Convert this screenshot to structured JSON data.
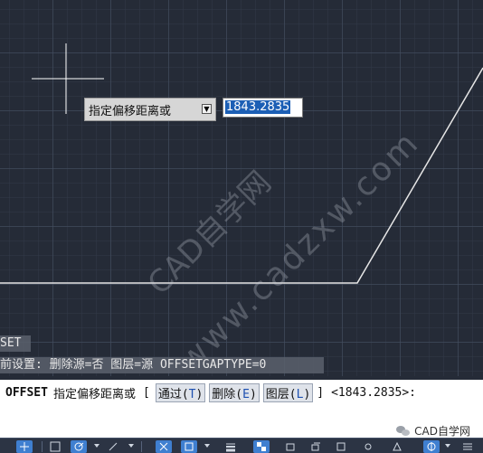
{
  "viewport": {
    "tooltip_prompt": "指定偏移距离或",
    "input_value": "1843.2835",
    "watermark_primary": "CAD自学网",
    "watermark_secondary": "www.cadzxw.com"
  },
  "command_history": {
    "line1": "SET",
    "line2": "前设置: 删除源=否  图层=源  OFFSETGAPTYPE=0"
  },
  "command_line": {
    "command": "OFFSET",
    "prompt": "指定偏移距离或",
    "open_bracket": "[",
    "options": [
      {
        "label": "通过(",
        "key": "T",
        "close": ")"
      },
      {
        "label": "删除(",
        "key": "E",
        "close": ")"
      },
      {
        "label": "图层(",
        "key": "L",
        "close": ")"
      }
    ],
    "close_bracket": "]",
    "default": "<1843.2835>:"
  },
  "footer": {
    "brand": "CAD自学网"
  },
  "status_bar": {
    "buttons": [
      "model-space-icon",
      "grid-icon",
      "snap-icon",
      "ortho-icon",
      "polar-icon",
      "isodraft-icon",
      "object-snap-tracking-icon",
      "object-snap-icon",
      "lineweight-icon",
      "transparency-icon",
      "selection-cycling-icon",
      "3d-osnap-icon",
      "dynamic-ucs-icon",
      "selection-filter-icon",
      "gizmo-icon",
      "annotation-visibility-icon",
      "autoscale-icon",
      "annotation-scale-icon",
      "workspace-icon",
      "customize-icon"
    ]
  },
  "colors": {
    "canvas_bg": "#252b37",
    "accent_blue": "#1c5fb5",
    "status_active": "#3f7fd0"
  }
}
